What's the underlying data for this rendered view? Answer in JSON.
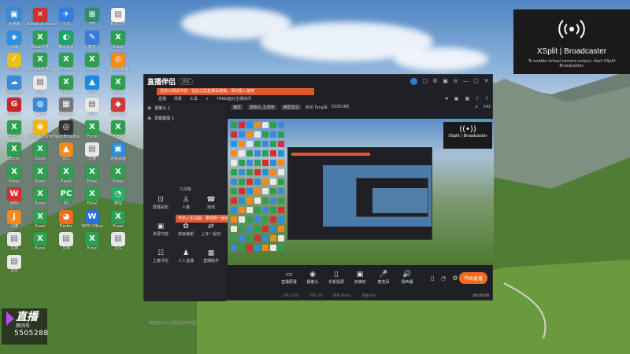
{
  "desktop": {
    "icons": [
      {
        "label": "此电脑",
        "color": "#3a8ad6",
        "glyph": "▣"
      },
      {
        "label": "Adobe Acrobat",
        "color": "#d32f2f",
        "glyph": "✕"
      },
      {
        "label": "飞书",
        "color": "#2f7ee0",
        "glyph": "✈"
      },
      {
        "label": "PPT",
        "color": "#2f8f6f",
        "glyph": "⊞"
      },
      {
        "label": "新建文件",
        "color": "#f2f2f2",
        "glyph": "▤"
      },
      {
        "label": "火绒",
        "color": "#2b8fd9",
        "glyph": "◈"
      },
      {
        "label": "Excel文件",
        "color": "#2e9e4f",
        "glyph": "X"
      },
      {
        "label": "腾讯会议",
        "color": "#1ea362",
        "glyph": "◐"
      },
      {
        "label": "笔记",
        "color": "#3a7bd5",
        "glyph": "✎"
      },
      {
        "label": "Excel",
        "color": "#2e9e4f",
        "glyph": "X"
      },
      {
        "label": "应用",
        "color": "#e8c21c",
        "glyph": "✓"
      },
      {
        "label": "Microsoft Edge",
        "color": "#2e9e4f",
        "glyph": "X"
      },
      {
        "label": "Excel",
        "color": "#2e9e4f",
        "glyph": "X"
      },
      {
        "label": "Excel",
        "color": "#2e9e4f",
        "glyph": "X"
      },
      {
        "label": "福昕阅读器",
        "color": "#f28a1d",
        "glyph": "◎"
      },
      {
        "label": "百度网盘",
        "color": "#3a8ad6",
        "glyph": "☁"
      },
      {
        "label": "文档",
        "color": "#e8e8e8",
        "glyph": "▤"
      },
      {
        "label": "Excel",
        "color": "#2e9e4f",
        "glyph": "X"
      },
      {
        "label": "迅雷",
        "color": "#1e88e5",
        "glyph": "▲"
      },
      {
        "label": "Excel",
        "color": "#2e9e4f",
        "glyph": "X"
      },
      {
        "label": "Foxmail",
        "color": "#c62828",
        "glyph": "G"
      },
      {
        "label": "Teams",
        "color": "#3a8ad6",
        "glyph": "◍"
      },
      {
        "label": "VMware",
        "color": "#777",
        "glyph": "▦"
      },
      {
        "label": "文档",
        "color": "#e8e8e8",
        "glyph": "▤"
      },
      {
        "label": "NetType",
        "color": "#d23a3a",
        "glyph": "◆"
      },
      {
        "label": "Excel",
        "color": "#2e9e4f",
        "glyph": "X"
      },
      {
        "label": "Google Chrome",
        "color": "#f4b400",
        "glyph": "◉"
      },
      {
        "label": "OpenBroadcaster",
        "color": "#333",
        "glyph": "◎"
      },
      {
        "label": "Excel",
        "color": "#2e9e4f",
        "glyph": "X"
      },
      {
        "label": "Excel",
        "color": "#2e9e4f",
        "glyph": "X"
      },
      {
        "label": "Excel",
        "color": "#2e9e4f",
        "glyph": "X"
      },
      {
        "label": "Excel",
        "color": "#2e9e4f",
        "glyph": "X"
      },
      {
        "label": "VLC",
        "color": "#f28a1d",
        "glyph": "▲"
      },
      {
        "label": "文档",
        "color": "#e8e8e8",
        "glyph": "▤"
      },
      {
        "label": "远程桌面",
        "color": "#2b8fd9",
        "glyph": "▣"
      },
      {
        "label": "Excel",
        "color": "#2e9e4f",
        "glyph": "X"
      },
      {
        "label": "Excel",
        "color": "#2e9e4f",
        "glyph": "X"
      },
      {
        "label": "Excel",
        "color": "#2e9e4f",
        "glyph": "X"
      },
      {
        "label": "Excel",
        "color": "#2e9e4f",
        "glyph": "X"
      },
      {
        "label": "Excel",
        "color": "#2e9e4f",
        "glyph": "X"
      },
      {
        "label": "WPS",
        "color": "#d33030",
        "glyph": "W"
      },
      {
        "label": "Excel",
        "color": "#2e9e4f",
        "glyph": "X"
      },
      {
        "label": "PC",
        "color": "#2e9e4f",
        "glyph": "PC"
      },
      {
        "label": "Excel",
        "color": "#2e9e4f",
        "glyph": "X"
      },
      {
        "label": "微信",
        "color": "#2aae67",
        "glyph": "◔"
      },
      {
        "label": "迅捷",
        "color": "#f28a1d",
        "glyph": "J"
      },
      {
        "label": "Excel",
        "color": "#2e9e4f",
        "glyph": "X"
      },
      {
        "label": "Firefox",
        "color": "#f26b1d",
        "glyph": "◕"
      },
      {
        "label": "WPS Office",
        "color": "#2b6fd9",
        "glyph": "W"
      },
      {
        "label": "Excel",
        "color": "#2e9e4f",
        "glyph": "X"
      },
      {
        "label": "文档",
        "color": "#e8e8e8",
        "glyph": "▤"
      },
      {
        "label": "Excel",
        "color": "#2e9e4f",
        "glyph": "X"
      },
      {
        "label": "文档",
        "color": "#e8e8e8",
        "glyph": "▤"
      },
      {
        "label": "Excel",
        "color": "#2e9e4f",
        "glyph": "X"
      },
      {
        "label": "文件",
        "color": "#e8e8e8",
        "glyph": "▤"
      },
      {
        "label": "文件",
        "color": "#e8e8e8",
        "glyph": "▤"
      }
    ]
  },
  "xsplit": {
    "name": "XSplit | Broadcaster",
    "hint": "To enable virtual camera output, start XSplit Broadcaster."
  },
  "badge": {
    "logo": "直播",
    "sub": "房间号",
    "number": "5505288"
  },
  "app": {
    "title": "直播伴侣",
    "version": "测试",
    "notice": "当前为测试内容，在此之前直播请谨慎，请勿投入使用",
    "menu": [
      "直播",
      "场景",
      "工具",
      "+",
      "TANG面对主播房间"
    ],
    "scenes": [
      {
        "label": "摄像头 1"
      },
      {
        "label": "屏幕截图 1"
      }
    ],
    "tools_title": "工具箱",
    "tools": [
      {
        "label": "屏幕投影",
        "glyph": "⊡"
      },
      {
        "label": "人像",
        "glyph": "♙"
      },
      {
        "label": "连线",
        "glyph": "☎"
      },
      {
        "label": "多屏内容",
        "glyph": "▣"
      },
      {
        "label": "高级美颜",
        "glyph": "✿"
      },
      {
        "label": "上车一起玩",
        "glyph": "⇄"
      },
      {
        "label": "上麦评论",
        "glyph": "☷"
      },
      {
        "label": "人人直播",
        "glyph": "♟"
      },
      {
        "label": "直播助手",
        "glyph": "▦"
      }
    ],
    "tooltip": "开启上车功能，带领粉一起玩游戏",
    "left_footer": "使用音乐平台语音连麦伴侣?",
    "preview_head": {
      "mode": "横屏",
      "item1": "摄像头·主场景",
      "item2": "横屏高清",
      "room_label": "房间·Tang哥",
      "room_id": "5505288",
      "viewers": "142"
    },
    "controls": [
      {
        "label": "直播屏幕",
        "glyph": "▭"
      },
      {
        "label": "摄像头",
        "glyph": "◉"
      },
      {
        "label": "手机投屏",
        "glyph": "▯"
      },
      {
        "label": "多媒体",
        "glyph": "▣"
      },
      {
        "label": "麦克风",
        "glyph": "🎤"
      },
      {
        "label": "扬声器",
        "glyph": "🔊"
      }
    ],
    "go_live": "开始直播",
    "status": {
      "cpu": "CPU 23%",
      "fps": "FPS 30",
      "bitrate": "码率 0kb/s",
      "dropped": "丢帧 0%",
      "time": "00:00:00"
    }
  }
}
